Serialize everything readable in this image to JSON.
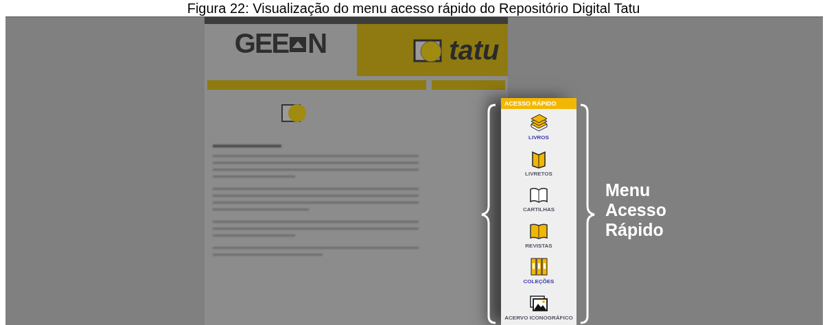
{
  "caption": "Figura 22: Visualização do menu acesso rápido do Repositório Digital Tatu",
  "page": {
    "logo": {
      "start": "GEE",
      "end": "N"
    },
    "brand": "tatu"
  },
  "quick_menu": {
    "title": "ACESSO RÁPIDO",
    "items": [
      {
        "label": "LIVROS",
        "kind": "books",
        "color": "#3a3ab0"
      },
      {
        "label": "LIVRETOS",
        "kind": "booklet",
        "color": "#555566"
      },
      {
        "label": "CARTILHAS",
        "kind": "open-book",
        "color": "#555566"
      },
      {
        "label": "REVISTAS",
        "kind": "magazine",
        "color": "#555566"
      },
      {
        "label": "COLEÇÕES",
        "kind": "binders",
        "color": "#3a3ab0"
      },
      {
        "label": "ACERVO ICONOGRÁFICO",
        "kind": "pictures",
        "color": "#555566"
      }
    ]
  },
  "annotation": "Menu Acesso Rápido"
}
